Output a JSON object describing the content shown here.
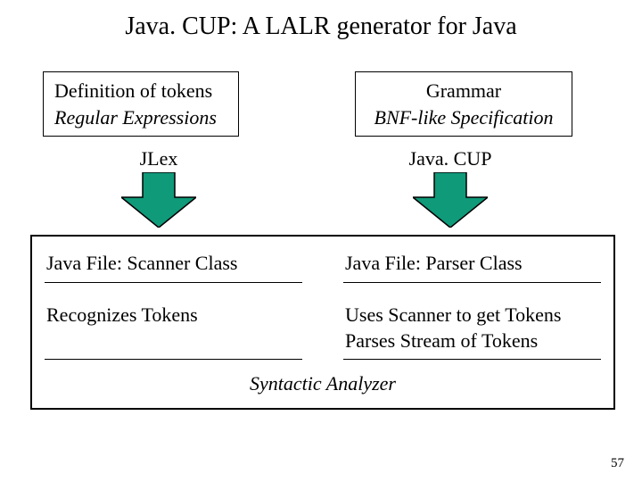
{
  "title": "Java. CUP: A LALR generator for Java",
  "top_left": {
    "line1": "Definition of tokens",
    "line2": "Regular Expressions"
  },
  "top_right": {
    "line1": "Grammar",
    "line2": "BNF-like Specification"
  },
  "arrows": {
    "left_label": "JLex",
    "right_label": "Java. CUP",
    "fill": "#0f9a7a",
    "stroke": "#000000"
  },
  "bottom": {
    "left_title": "Java File: Scanner Class",
    "right_title": "Java File: Parser Class",
    "left_desc": "Recognizes Tokens",
    "right_desc": "Uses Scanner to get Tokens\nParses Stream of Tokens",
    "footer": "Syntactic Analyzer"
  },
  "page_number": "57"
}
